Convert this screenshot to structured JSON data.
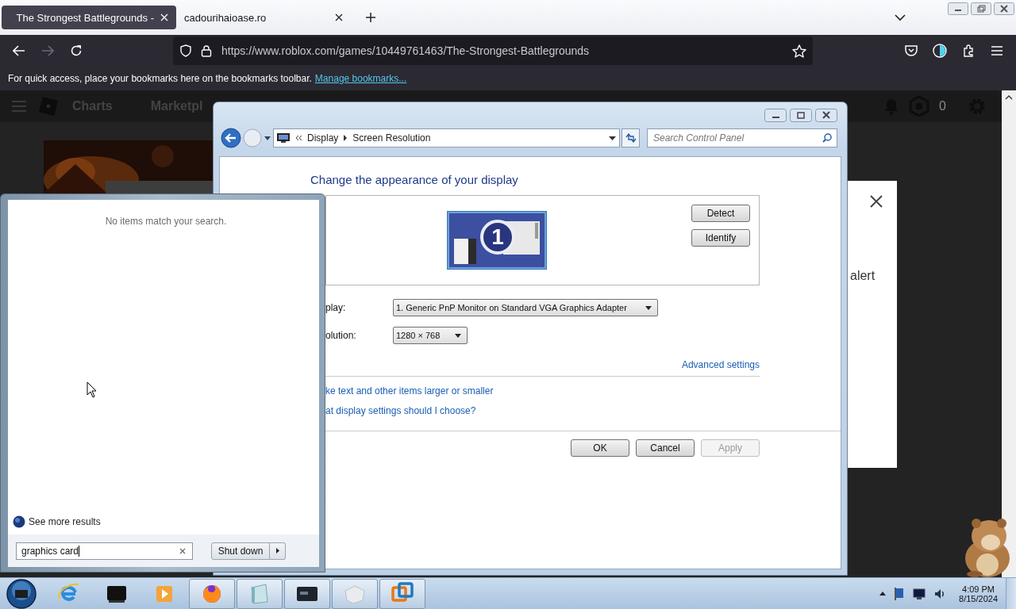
{
  "browser": {
    "tabs": [
      {
        "title": "The Strongest Battlegrounds -",
        "selected": true
      },
      {
        "title": "cadourihaioase.ro",
        "selected": false
      }
    ],
    "address": "https://www.roblox.com/games/10449761463/The-Strongest-Battlegrounds",
    "bookmarks_bar": {
      "message": "For quick access, place your bookmarks here on the bookmarks toolbar.",
      "link": "Manage bookmarks..."
    }
  },
  "page": {
    "nav": [
      "Charts",
      "Marketpl"
    ],
    "robux": "0",
    "modal_text": "alert"
  },
  "control_panel": {
    "breadcrumb": [
      "Display",
      "Screen Resolution"
    ],
    "search_placeholder": "Search Control Panel",
    "heading": "Change the appearance of your display",
    "monitor_number": "1",
    "side_buttons": [
      "Detect",
      "Identify"
    ],
    "fields": [
      {
        "label": "play:",
        "value": "1. Generic PnP Monitor on Standard VGA Graphics Adapter"
      },
      {
        "label": "olution:",
        "value": "1280 × 768"
      }
    ],
    "advanced_link": "Advanced settings",
    "links": [
      "ke text and other items larger or smaller",
      "at display settings should I choose?"
    ],
    "buttons": [
      {
        "label": "OK",
        "disabled": false
      },
      {
        "label": "Cancel",
        "disabled": false
      },
      {
        "label": "Apply",
        "disabled": true
      }
    ]
  },
  "start_menu": {
    "message": "No items match your search.",
    "more_results": "See more results",
    "search_value": "graphics card",
    "shutdown": "Shut down"
  },
  "taskbar": {
    "apps": [
      {
        "running": false
      },
      {
        "running": false
      },
      {
        "running": false
      },
      {
        "running": true
      },
      {
        "running": true
      },
      {
        "running": true
      },
      {
        "running": true
      },
      {
        "running": true
      }
    ],
    "clock": {
      "time": "4:09 PM",
      "date": "8/15/2024"
    }
  }
}
